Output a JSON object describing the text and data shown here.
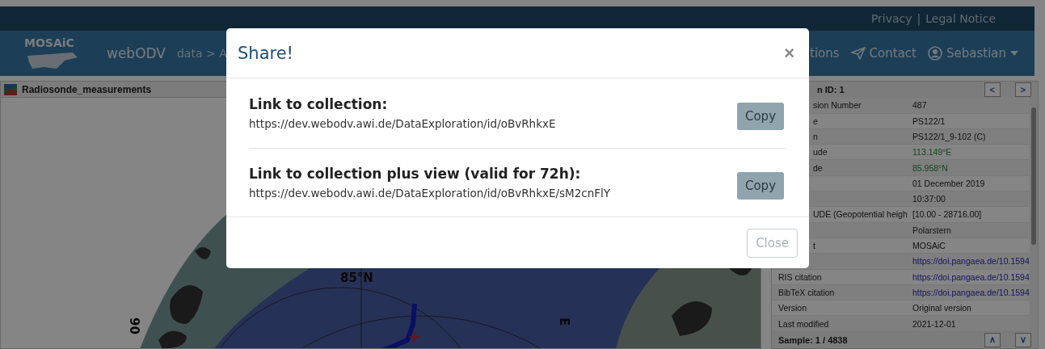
{
  "top_bar": {
    "links": [
      "Privacy",
      "Legal Notice"
    ],
    "separator": "|"
  },
  "nav": {
    "logo": "MOSAiC",
    "app": "webODV",
    "breadcrumb": "data > A",
    "items": [
      {
        "kind": "link",
        "label": "tions"
      },
      {
        "kind": "contact",
        "label": "Contact"
      },
      {
        "kind": "user",
        "label": "Sebastian"
      }
    ]
  },
  "left_panel": {
    "title": "Radiosonde_measurements",
    "map_labels": [
      {
        "kind": "parallel",
        "text": "85°N"
      },
      {
        "kind": "left",
        "text": "90"
      },
      {
        "kind": "right",
        "text": "E"
      }
    ]
  },
  "right_panel": {
    "header": "n ID: 1",
    "nav_buttons": [
      "<",
      ">"
    ],
    "rows": [
      {
        "kind": "plain",
        "label": "sion Number",
        "value": "487"
      },
      {
        "kind": "plain",
        "label": "e",
        "value": "PS122/1"
      },
      {
        "kind": "plain",
        "label": "n",
        "value": "PS122/1_9-102 (C)"
      },
      {
        "kind": "coord",
        "label": "ude",
        "value": "113.149°E"
      },
      {
        "kind": "coord",
        "label": "de",
        "value": "85.958°N"
      },
      {
        "kind": "plain",
        "value": "01 December 2019"
      },
      {
        "kind": "plain",
        "value": "10:37:00"
      },
      {
        "kind": "plain",
        "label": "UDE (Geopotential heigh",
        "value": "[10.00 - 28716.00]"
      },
      {
        "kind": "plain",
        "value": "Polarstern"
      },
      {
        "kind": "plain",
        "label": "t",
        "value": "MOSAiC"
      },
      {
        "kind": "link",
        "value": "https://doi.pangaea.de/10.1594"
      },
      {
        "kind": "link",
        "label": "RIS citation",
        "value": "https://doi.pangaea.de/10.1594"
      },
      {
        "kind": "link",
        "label": "BibTeX citation",
        "value": "https://doi.pangaea.de/10.1594"
      },
      {
        "kind": "plain",
        "label": "Version",
        "value": "Original version"
      },
      {
        "kind": "plain",
        "label": "Last modified",
        "value": "2021-12-01"
      }
    ],
    "footer": "Sample: 1 / 4838",
    "footer_buttons": [
      "∧",
      "∨"
    ]
  },
  "modal": {
    "title": "Share!",
    "close": "×",
    "sections": [
      {
        "heading": "Link to collection:",
        "url": "https://dev.webodv.awi.de/DataExploration/id/oBvRhkxE",
        "button": "Copy"
      },
      {
        "heading": "Link to collection plus view (valid for 72h):",
        "url": "https://dev.webodv.awi.de/DataExploration/id/oBvRhkxE/sM2cnFlY",
        "button": "Copy"
      }
    ],
    "footer_button": "Close"
  }
}
